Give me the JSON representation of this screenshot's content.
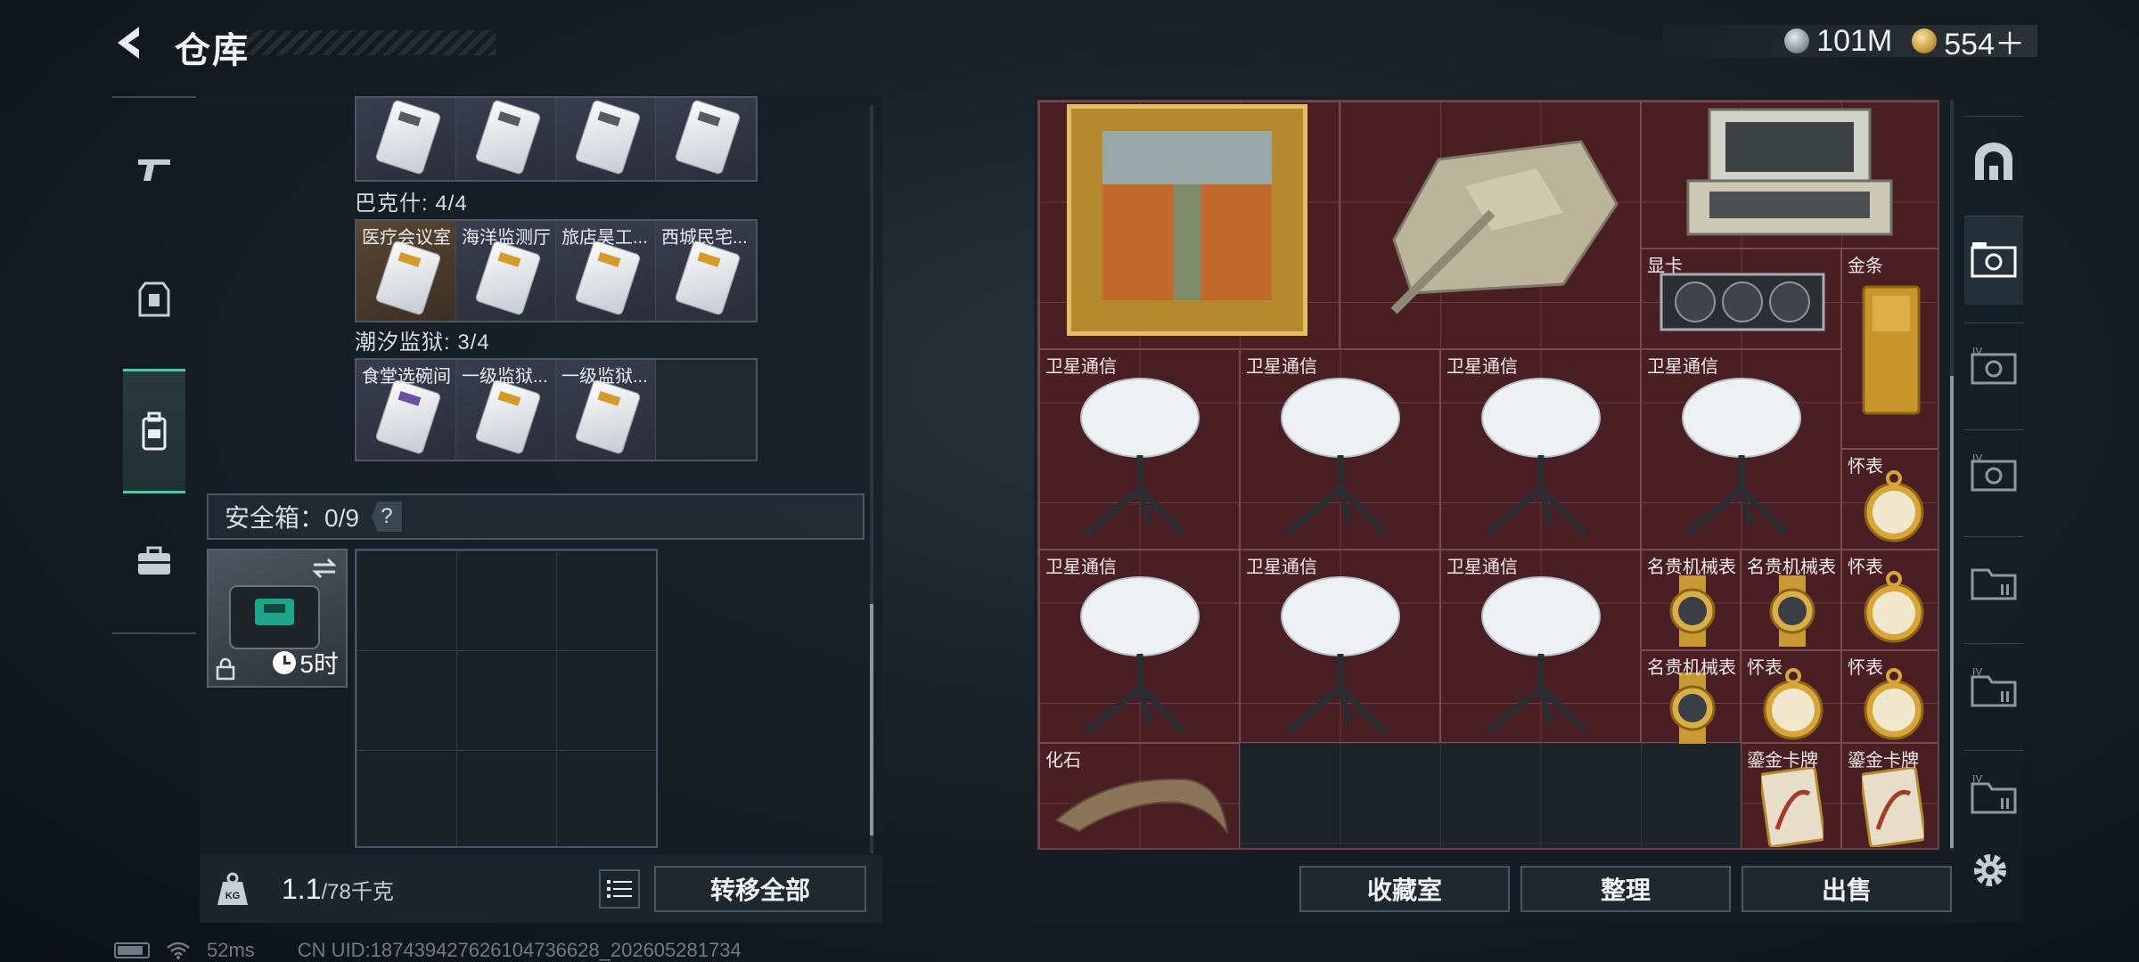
{
  "header": {
    "title": "仓库",
    "currency": [
      {
        "icon": "silver-coin-icon",
        "value": "101M"
      },
      {
        "icon": "gold-coin-icon",
        "value": "554＋"
      }
    ]
  },
  "left_rail": {
    "items": [
      {
        "icon": "gun-icon",
        "active": false
      },
      {
        "icon": "armor-icon",
        "active": false
      },
      {
        "icon": "backpack-icon",
        "active": true
      },
      {
        "icon": "toolbox-icon",
        "active": false
      }
    ]
  },
  "keycards": {
    "row_top": {
      "items": [
        "",
        "",
        "",
        ""
      ]
    },
    "group1": {
      "label": "巴克什: 4/4",
      "items": [
        "医疗会议室",
        "海洋监测厅",
        "旅店昊工...",
        "西城民宅..."
      ]
    },
    "group2": {
      "label": "潮汐监狱: 3/4",
      "items": [
        "食堂选碗间",
        "一级监狱...",
        "一级监狱...",
        ""
      ]
    }
  },
  "safe": {
    "header": "安全箱：0/9",
    "help": "?",
    "timer": "5时"
  },
  "weight": {
    "current": "1.1",
    "max": "/78千克"
  },
  "buttons": {
    "transfer_all": "转移全部",
    "collection_room": "收藏室",
    "organize": "整理",
    "sell": "出售"
  },
  "stash_items": {
    "painting": "",
    "tank": "",
    "case": "",
    "gpu": "显卡",
    "gold_bar": "金条",
    "sat1": "卫星通信",
    "sat2": "卫星通信",
    "sat3": "卫星通信",
    "sat4": "卫星通信",
    "sat5": "卫星通信",
    "sat6": "卫星通信",
    "sat7": "卫星通信",
    "pocket_watch1": "怀表",
    "pocket_watch2": "怀表",
    "pocket_watch3": "怀表",
    "pocket_watch4": "怀表",
    "watch1": "名贵机械表",
    "watch2": "名贵机械表",
    "watch3": "名贵机械表",
    "fossil": "化石",
    "card1": "鎏金卡牌",
    "card2": "鎏金卡牌"
  },
  "status": {
    "ping": "52ms",
    "uid": "CN UID:1874394276261047366​28_202605281734"
  },
  "colors": {
    "accent": "#3fd1a1",
    "stash_bg": "#4a1f24"
  }
}
